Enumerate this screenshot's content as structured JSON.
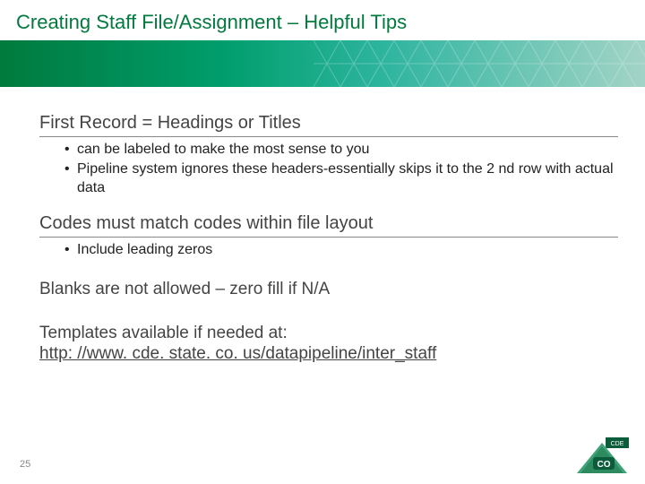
{
  "title": "Creating Staff File/Assignment – Helpful Tips",
  "section1": {
    "heading": "First Record = Headings or Titles",
    "b1": "can be labeled to make the most sense to you",
    "b2": "Pipeline system ignores these headers-essentially skips it to the 2 nd row with actual data"
  },
  "section2": {
    "heading": "Codes must match codes within file layout",
    "b1": "Include leading zeros"
  },
  "section3": {
    "heading": "Blanks are not allowed – zero fill if N/A"
  },
  "section4": {
    "heading": "Templates available if needed at:",
    "link": "http: //www. cde. state. co. us/datapipeline/inter_staff"
  },
  "page_number": "25",
  "logo": {
    "top_label": "CDE",
    "main_label": "CO"
  }
}
